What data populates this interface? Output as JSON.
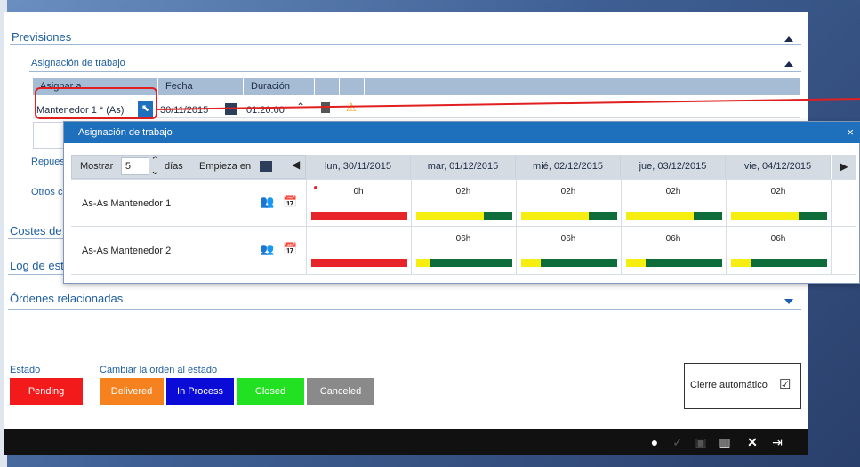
{
  "sections": {
    "previsiones": "Previsiones",
    "asignacion": "Asignación de trabajo",
    "repuestos": "Repues",
    "otros": "Otros c",
    "costes": "Costes de",
    "log": "Log de est",
    "ordenes": "Órdenes relacionadas"
  },
  "grid": {
    "headers": [
      "Asignar a",
      "Fecha",
      "Duración"
    ],
    "row": {
      "assignee": "Mantenedor 1 * (As)",
      "date": "30/11/2015",
      "duration": "01:20:00"
    }
  },
  "dialog": {
    "title": "Asignación de trabajo",
    "close": "×",
    "show_label": "Mostrar",
    "show_value": "5",
    "days_label": "días",
    "starts_label": "Empieza en",
    "days": [
      "lun, 30/11/2015",
      "mar, 01/12/2015",
      "mié, 02/12/2015",
      "jue, 03/12/2015",
      "vie, 04/12/2015"
    ],
    "resources": [
      {
        "name": "As-As Mantenedor 1",
        "hours": [
          "0h",
          "02h",
          "02h",
          "02h",
          "02h"
        ],
        "loads": [
          {
            "yellow": 0,
            "green": 0,
            "red": 1
          },
          {
            "yellow": 0.7,
            "green": 0.3,
            "red": 0
          },
          {
            "yellow": 0.7,
            "green": 0.3,
            "red": 0
          },
          {
            "yellow": 0.7,
            "green": 0.3,
            "red": 0
          },
          {
            "yellow": 0.7,
            "green": 0.3,
            "red": 0
          }
        ]
      },
      {
        "name": "As-As Mantenedor 2",
        "hours": [
          "",
          "06h",
          "06h",
          "06h",
          "06h"
        ],
        "loads": [
          {
            "yellow": 0,
            "green": 0,
            "red": 1
          },
          {
            "yellow": 0.15,
            "green": 0.85,
            "red": 0
          },
          {
            "yellow": 0.2,
            "green": 0.8,
            "red": 0
          },
          {
            "yellow": 0.2,
            "green": 0.8,
            "red": 0
          },
          {
            "yellow": 0.2,
            "green": 0.8,
            "red": 0
          }
        ]
      }
    ]
  },
  "estado": {
    "label": "Estado",
    "change_label": "Cambiar la orden al estado",
    "current": "Pending",
    "options": [
      {
        "label": "Delivered",
        "color": "#f5821f"
      },
      {
        "label": "In Process",
        "color": "#0b0bd8"
      },
      {
        "label": "Closed",
        "color": "#22e022"
      },
      {
        "label": "Canceled",
        "color": "#8a8a8a"
      }
    ],
    "current_color": "#f21a1a"
  },
  "auto_close": "Cierre automático",
  "colors": {
    "red": "#e8242b",
    "yellow": "#f6ee10",
    "green": "#0e6b3a",
    "accent": "#1e6fbc"
  }
}
